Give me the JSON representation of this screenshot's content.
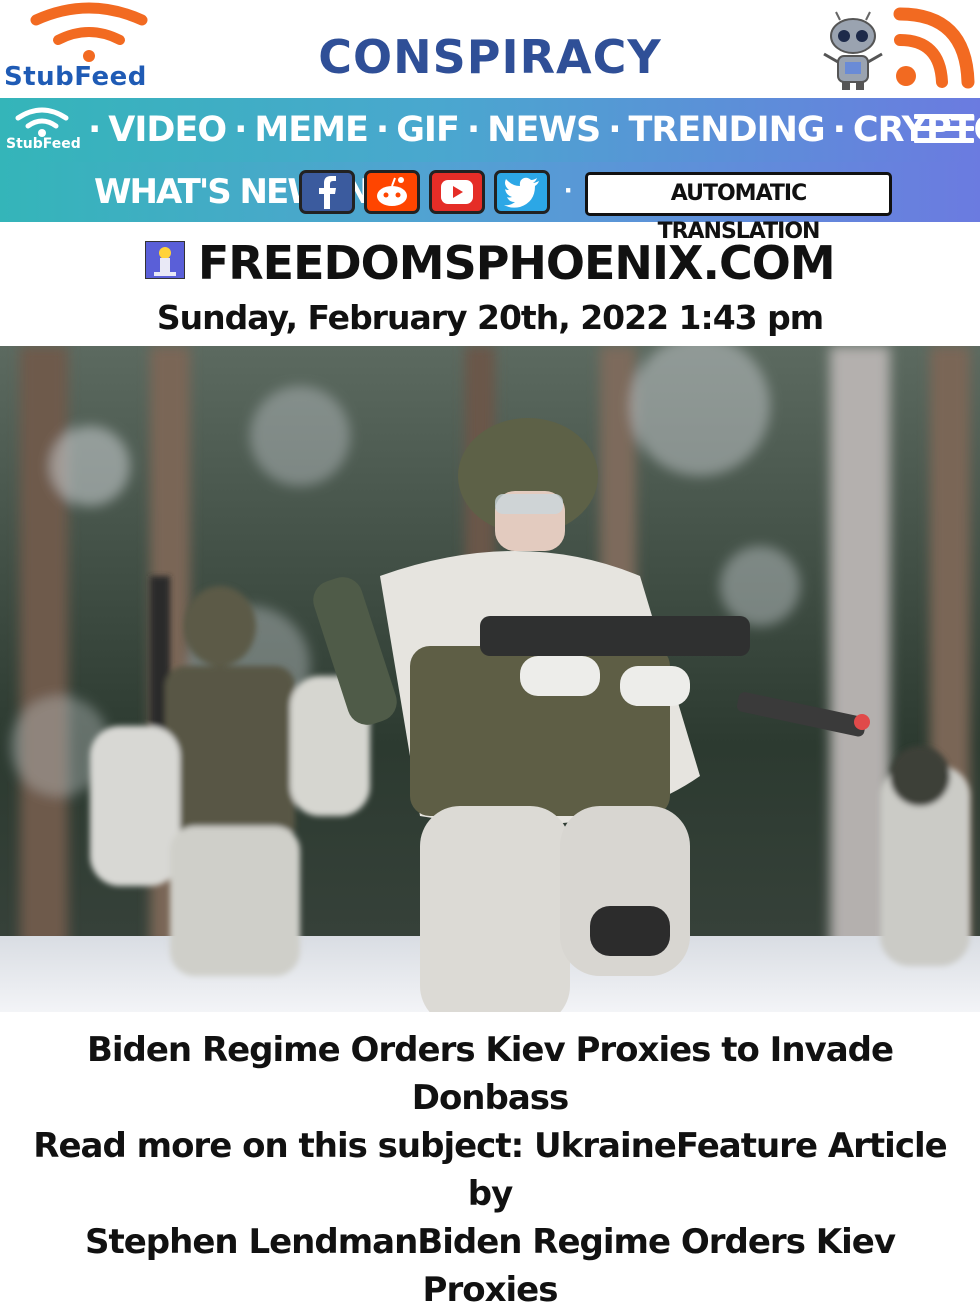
{
  "header": {
    "brand": "StubFeed",
    "category": "CONSPIRACY",
    "colors": {
      "brand_blue": "#1f5bb5",
      "rss_orange": "#f26a21",
      "category_blue": "#2f4f97"
    }
  },
  "nav": {
    "brand": "StubFeed",
    "items": [
      "VIDEO",
      "MEME",
      "GIF",
      "NEWS",
      "TRENDING",
      "CRYPTO"
    ],
    "menu_icon": "hamburger-menu-icon"
  },
  "subnav": {
    "whats_new": "WHAT'S NEW IN",
    "socials": [
      "facebook-icon",
      "reddit-icon",
      "youtube-icon",
      "twitter-icon"
    ],
    "translate": "AUTOMATIC TRANSLATION"
  },
  "article": {
    "source": "FREEDOMSPHOENIX.COM",
    "date": "Sunday, February 20th, 2022 1:43 pm",
    "headline_lines": [
      "Biden Regime Orders Kiev Proxies to Invade Donbass",
      "Read more on this subject: UkraineFeature Article by",
      "Stephen LendmanBiden Regime Orders Kiev Proxies"
    ]
  }
}
